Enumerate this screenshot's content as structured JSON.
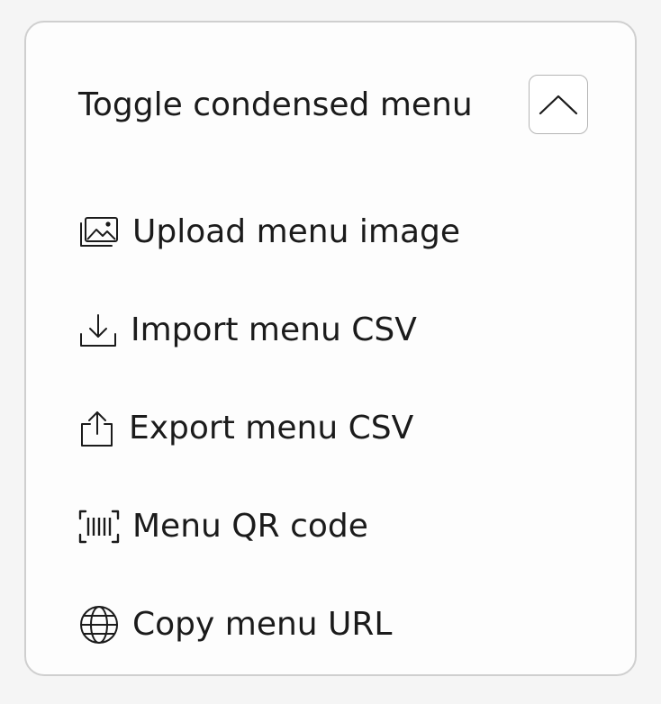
{
  "panel": {
    "title": "Toggle condensed menu",
    "toggle_icon": "chevron-up-icon"
  },
  "items": [
    {
      "label": "Upload menu image",
      "icon": "image-upload-icon"
    },
    {
      "label": "Import menu CSV",
      "icon": "download-icon"
    },
    {
      "label": "Export menu CSV",
      "icon": "share-upload-icon"
    },
    {
      "label": "Menu QR code",
      "icon": "barcode-scan-icon"
    },
    {
      "label": "Copy menu URL",
      "icon": "globe-icon"
    }
  ],
  "colors": {
    "text": "#1b1b1b",
    "border": "#cfcfcf",
    "background": "#f5f5f5",
    "card": "#fdfdfd"
  }
}
